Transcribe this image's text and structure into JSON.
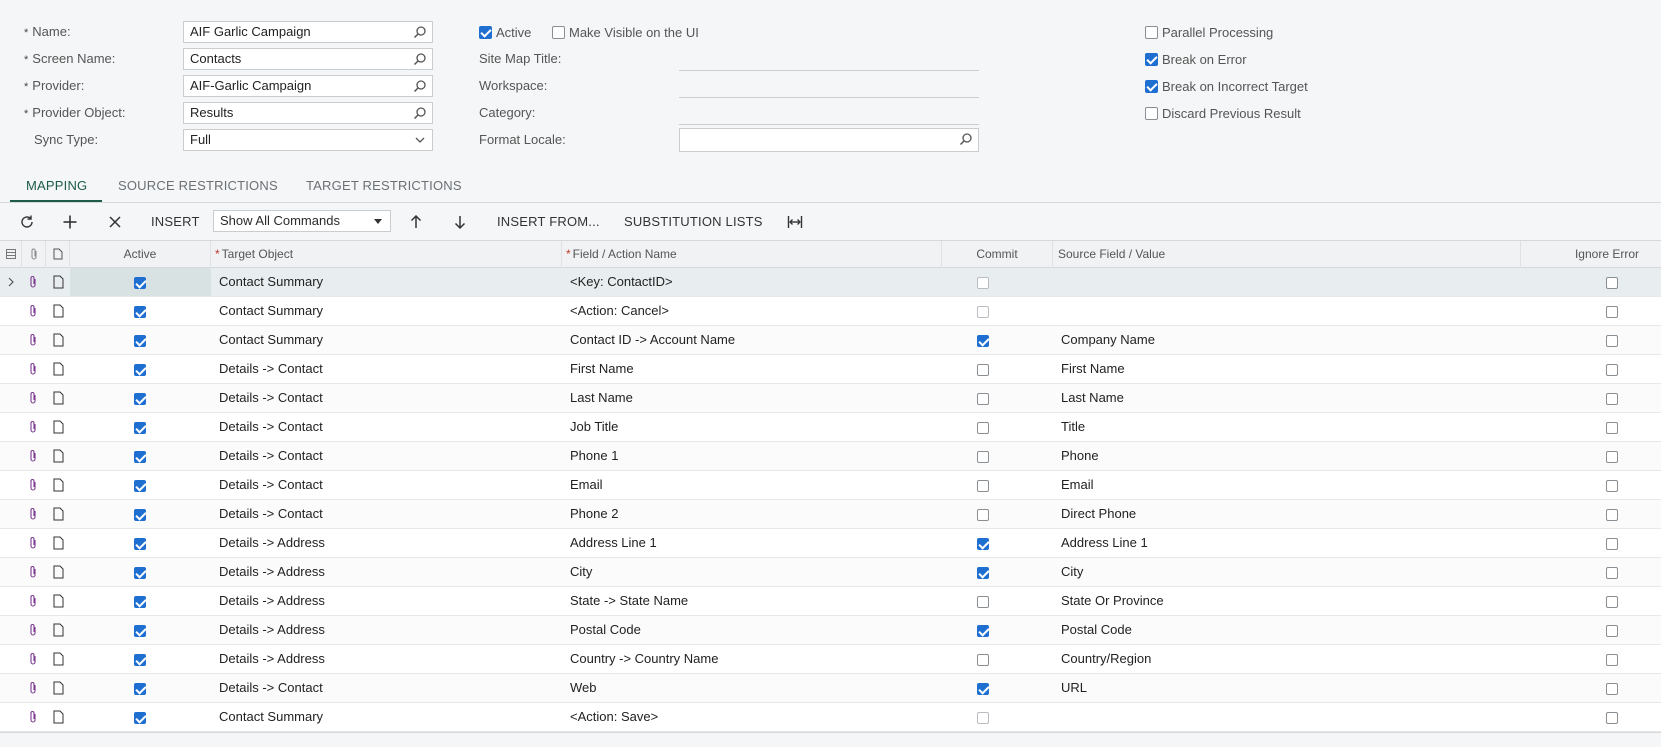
{
  "form": {
    "name": {
      "label": "Name:",
      "value": "AIF Garlic Campaign"
    },
    "screen_name": {
      "label": "Screen Name:",
      "value": "Contacts"
    },
    "provider": {
      "label": "Provider:",
      "value": "AIF-Garlic Campaign"
    },
    "provider_object": {
      "label": "Provider Object:",
      "value": "Results"
    },
    "sync_type": {
      "label": "Sync Type:",
      "value": "Full"
    },
    "active": {
      "label": "Active",
      "checked": true
    },
    "make_visible": {
      "label": "Make Visible on the UI",
      "checked": false
    },
    "site_map_title": {
      "label": "Site Map Title:",
      "value": ""
    },
    "workspace": {
      "label": "Workspace:",
      "value": ""
    },
    "category": {
      "label": "Category:",
      "value": ""
    },
    "format_locale": {
      "label": "Format Locale:",
      "value": ""
    },
    "parallel_processing": {
      "label": "Parallel Processing",
      "checked": false
    },
    "break_on_error": {
      "label": "Break on Error",
      "checked": true
    },
    "break_on_incorrect_target": {
      "label": "Break on Incorrect Target",
      "checked": true
    },
    "discard_previous_result": {
      "label": "Discard Previous Result",
      "checked": false
    }
  },
  "tabs": [
    {
      "label": "MAPPING",
      "active": true
    },
    {
      "label": "SOURCE RESTRICTIONS",
      "active": false
    },
    {
      "label": "TARGET RESTRICTIONS",
      "active": false
    }
  ],
  "toolbar": {
    "insert_label": "INSERT",
    "command_filter": "Show All Commands",
    "insert_from_label": "INSERT FROM...",
    "substitution_lists_label": "SUBSTITUTION LISTS"
  },
  "grid": {
    "columns": {
      "active": "Active",
      "target_object": "Target Object",
      "field_action": "Field / Action Name",
      "commit": "Commit",
      "source_field": "Source Field / Value",
      "ignore_error": "Ignore Error"
    },
    "rows": [
      {
        "active": true,
        "target": "Contact Summary",
        "field": "<Key: ContactID>",
        "commit": false,
        "commit_disabled": true,
        "source": "",
        "ignore": false
      },
      {
        "active": true,
        "target": "Contact Summary",
        "field": "<Action: Cancel>",
        "commit": false,
        "commit_disabled": true,
        "source": "",
        "ignore": false
      },
      {
        "active": true,
        "target": "Contact Summary",
        "field": "Contact ID -> Account Name",
        "commit": true,
        "commit_disabled": false,
        "source": "Company Name",
        "ignore": false
      },
      {
        "active": true,
        "target": "Details -> Contact",
        "field": "First Name",
        "commit": false,
        "commit_disabled": false,
        "source": "First Name",
        "ignore": false
      },
      {
        "active": true,
        "target": "Details -> Contact",
        "field": "Last Name",
        "commit": false,
        "commit_disabled": false,
        "source": "Last Name",
        "ignore": false
      },
      {
        "active": true,
        "target": "Details -> Contact",
        "field": "Job Title",
        "commit": false,
        "commit_disabled": false,
        "source": "Title",
        "ignore": false
      },
      {
        "active": true,
        "target": "Details -> Contact",
        "field": "Phone 1",
        "commit": false,
        "commit_disabled": false,
        "source": "Phone",
        "ignore": false
      },
      {
        "active": true,
        "target": "Details -> Contact",
        "field": "Email",
        "commit": false,
        "commit_disabled": false,
        "source": "Email",
        "ignore": false
      },
      {
        "active": true,
        "target": "Details -> Contact",
        "field": "Phone 2",
        "commit": false,
        "commit_disabled": false,
        "source": "Direct Phone",
        "ignore": false
      },
      {
        "active": true,
        "target": "Details -> Address",
        "field": "Address Line 1",
        "commit": true,
        "commit_disabled": false,
        "source": "Address Line 1",
        "ignore": false
      },
      {
        "active": true,
        "target": "Details -> Address",
        "field": "City",
        "commit": true,
        "commit_disabled": false,
        "source": "City",
        "ignore": false
      },
      {
        "active": true,
        "target": "Details -> Address",
        "field": "State -> State Name",
        "commit": false,
        "commit_disabled": false,
        "source": "State Or Province",
        "ignore": false
      },
      {
        "active": true,
        "target": "Details -> Address",
        "field": "Postal Code",
        "commit": true,
        "commit_disabled": false,
        "source": "Postal Code",
        "ignore": false
      },
      {
        "active": true,
        "target": "Details -> Address",
        "field": "Country -> Country Name",
        "commit": false,
        "commit_disabled": false,
        "source": "Country/Region",
        "ignore": false
      },
      {
        "active": true,
        "target": "Details -> Contact",
        "field": "Web",
        "commit": true,
        "commit_disabled": false,
        "source": "URL",
        "ignore": false
      },
      {
        "active": true,
        "target": "Contact Summary",
        "field": "<Action: Save>",
        "commit": false,
        "commit_disabled": true,
        "source": "",
        "ignore": false
      }
    ]
  }
}
